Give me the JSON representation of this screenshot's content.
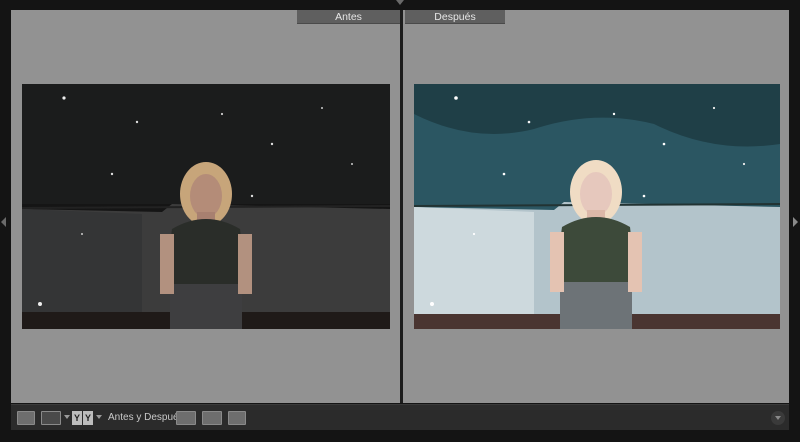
{
  "compare": {
    "before_label": "Antes",
    "after_label": "Después"
  },
  "toolbar": {
    "mode_label": "Antes y Después:",
    "yy_left": "Y",
    "yy_right": "Y"
  },
  "icons": {
    "loupe": "single-view-icon",
    "compare": "compare-view-icon",
    "before_after": "before-after-view-icon",
    "swap": "swap-settings-icon",
    "copy_before": "copy-before-to-after-icon",
    "copy_after": "copy-after-to-before-icon",
    "menu": "toolbar-menu-icon"
  },
  "colors": {
    "pane_bg": "#929292",
    "label_bg": "#5f5f5f",
    "toolbar_bg": "#2b2b2b",
    "before_sky": "#141414",
    "after_sky": "#2d5a66"
  }
}
